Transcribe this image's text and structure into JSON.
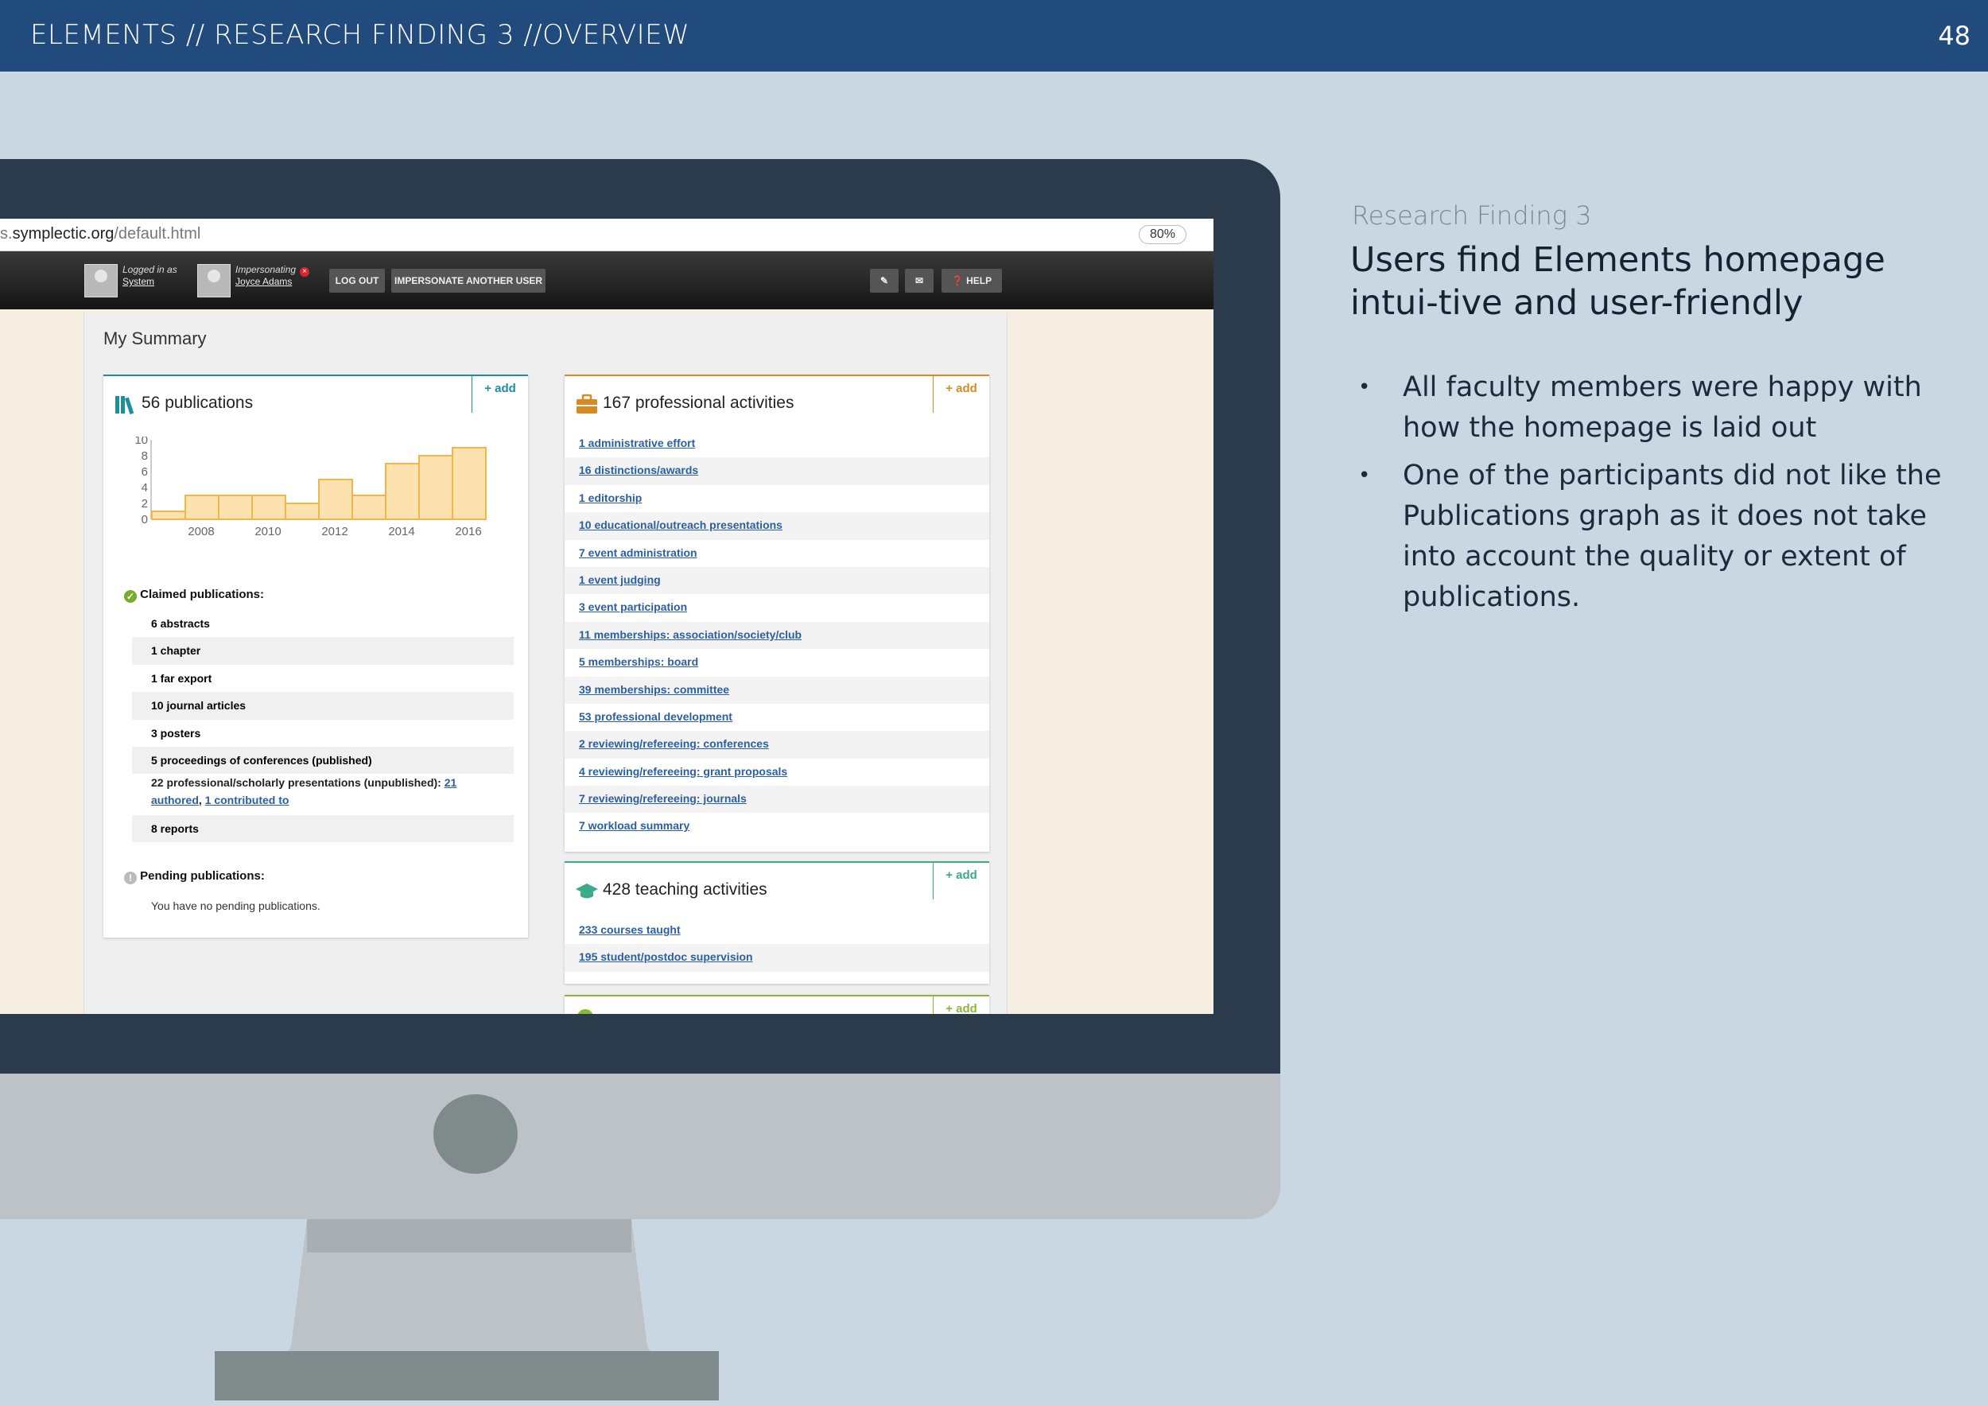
{
  "header": {
    "title": "ELEMENTS // RESEARCH FINDING 3 //OVERVIEW",
    "page_number": "48"
  },
  "browser": {
    "url_prefix": "s.",
    "url_domain": "symplectic.org",
    "url_path": "/default.html",
    "zoom": "80%"
  },
  "navbar": {
    "logged_in_label": "Logged in as",
    "logged_in_user": "System",
    "impersonating_label": "Impersonating",
    "impersonated_user": "Joyce Adams",
    "logout": "LOG OUT",
    "impersonate_another": "IMPERSONATE ANOTHER USER",
    "help": "HELP"
  },
  "summary": {
    "title": "My Summary",
    "add_label": "+ add"
  },
  "publications": {
    "title": "56 publications",
    "claimed_heading": "Claimed publications:",
    "claimed_items": [
      "6 abstracts",
      "1 chapter",
      "1 far export",
      "10 journal articles",
      "3 posters",
      "5 proceedings of conferences (published)"
    ],
    "unpublished_prefix": "22 professional/scholarly presentations (unpublished): ",
    "unpublished_link1": "21 authored",
    "unpublished_sep": ", ",
    "unpublished_link2": "1 contributed to",
    "reports_item": "8 reports",
    "pending_heading": "Pending publications:",
    "pending_text": "You have no pending publications."
  },
  "chart_data": {
    "type": "bar",
    "categories": [
      "2007",
      "2008",
      "2009",
      "2010",
      "2011",
      "2012",
      "2013",
      "2014",
      "2015",
      "2016",
      "2017"
    ],
    "values": [
      1,
      3,
      3,
      3,
      2,
      5,
      3,
      7,
      8,
      9,
      0
    ],
    "x_tick_labels": [
      "2008",
      "2010",
      "2012",
      "2014",
      "2016"
    ],
    "y_tick_labels": [
      "0",
      "2",
      "4",
      "6",
      "8",
      "10"
    ],
    "ylim": [
      0,
      10
    ],
    "bar_color": "#fde2b0",
    "bar_edge_color": "#f0b64a"
  },
  "professional": {
    "title": "167 professional activities",
    "items": [
      "1 administrative effort",
      "16 distinctions/awards",
      "1 editorship",
      "10 educational/outreach presentations",
      "7 event administration",
      "1 event judging",
      "3 event participation",
      "11 memberships: association/society/club",
      "5 memberships: board",
      "39 memberships: committee",
      "53 professional development",
      "2 reviewing/refereeing: conferences",
      "4 reviewing/refereeing: grant proposals",
      "7 reviewing/refereeing: journals",
      "7 workload summary"
    ]
  },
  "teaching": {
    "title": "428 teaching activities",
    "items": [
      "233 courses taught",
      "195 student/postdoc supervision"
    ]
  },
  "colors": {
    "header_bg": "#214b7d",
    "publications_accent": "#1f8fa0",
    "professional_accent": "#d78a22",
    "teaching_accent": "#3aaa8c",
    "link": "#2b5fa3"
  },
  "sidebar": {
    "eyebrow": "Research Finding 3",
    "headline": "Users find Elements homepage intui-tive and user-friendly",
    "bullets": [
      "All faculty members were happy with how the homepage is laid out",
      "One of the participants did not like the Publications graph as it does not take into account the quality or extent of publications."
    ]
  }
}
